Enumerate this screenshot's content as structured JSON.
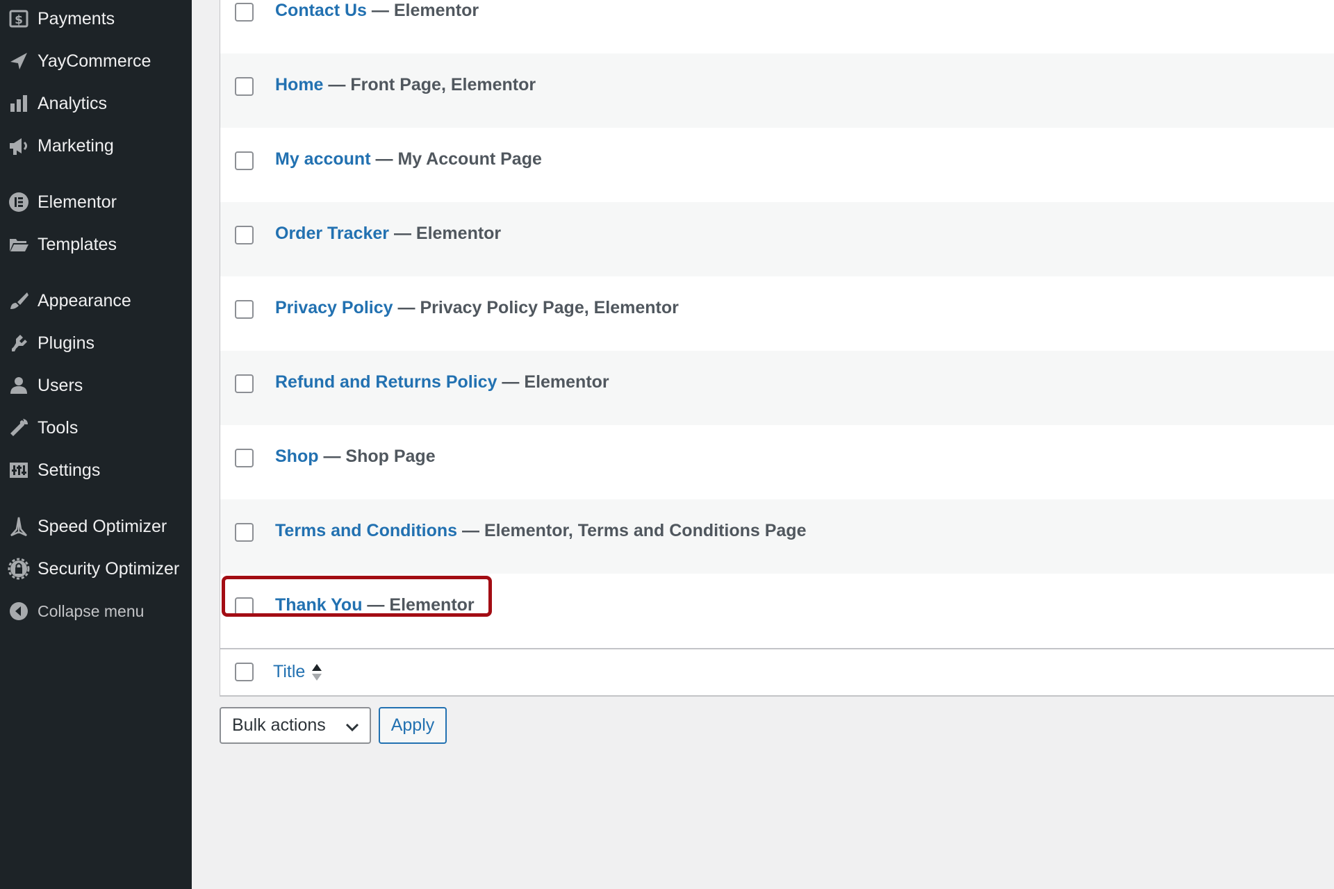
{
  "sidebar": {
    "items": [
      {
        "label": "Payments",
        "icon": "payments-icon"
      },
      {
        "label": "YayCommerce",
        "icon": "yaycommerce-icon"
      },
      {
        "label": "Analytics",
        "icon": "analytics-icon"
      },
      {
        "label": "Marketing",
        "icon": "marketing-icon"
      },
      {
        "label": "Elementor",
        "icon": "elementor-icon"
      },
      {
        "label": "Templates",
        "icon": "templates-icon"
      },
      {
        "label": "Appearance",
        "icon": "appearance-icon"
      },
      {
        "label": "Plugins",
        "icon": "plugins-icon"
      },
      {
        "label": "Users",
        "icon": "users-icon"
      },
      {
        "label": "Tools",
        "icon": "tools-icon"
      },
      {
        "label": "Settings",
        "icon": "settings-icon"
      },
      {
        "label": "Speed Optimizer",
        "icon": "speed-optimizer-icon"
      },
      {
        "label": "Security Optimizer",
        "icon": "security-optimizer-icon"
      }
    ],
    "collapse_label": "Collapse menu"
  },
  "pages": {
    "rows": [
      {
        "title": "Contact Us",
        "sep": " — ",
        "state": "Elementor"
      },
      {
        "title": "Home",
        "sep": " — ",
        "state": "Front Page, Elementor"
      },
      {
        "title": "My account",
        "sep": " — ",
        "state": "My Account Page"
      },
      {
        "title": "Order Tracker",
        "sep": " — ",
        "state": "Elementor"
      },
      {
        "title": "Privacy Policy",
        "sep": " — ",
        "state": "Privacy Policy Page, Elementor"
      },
      {
        "title": "Refund and Returns Policy",
        "sep": " — ",
        "state": "Elementor"
      },
      {
        "title": "Shop",
        "sep": " — ",
        "state": "Shop Page"
      },
      {
        "title": "Terms and Conditions",
        "sep": " — ",
        "state": "Elementor, Terms and Conditions Page"
      },
      {
        "title": "Thank You",
        "sep": " — ",
        "state": "Elementor"
      }
    ],
    "footer_column": "Title"
  },
  "bulk": {
    "select_value": "Bulk actions",
    "apply_label": "Apply"
  },
  "colors": {
    "sidebar_bg": "#1d2327",
    "link": "#2271b1",
    "highlight": "#a30d14"
  }
}
